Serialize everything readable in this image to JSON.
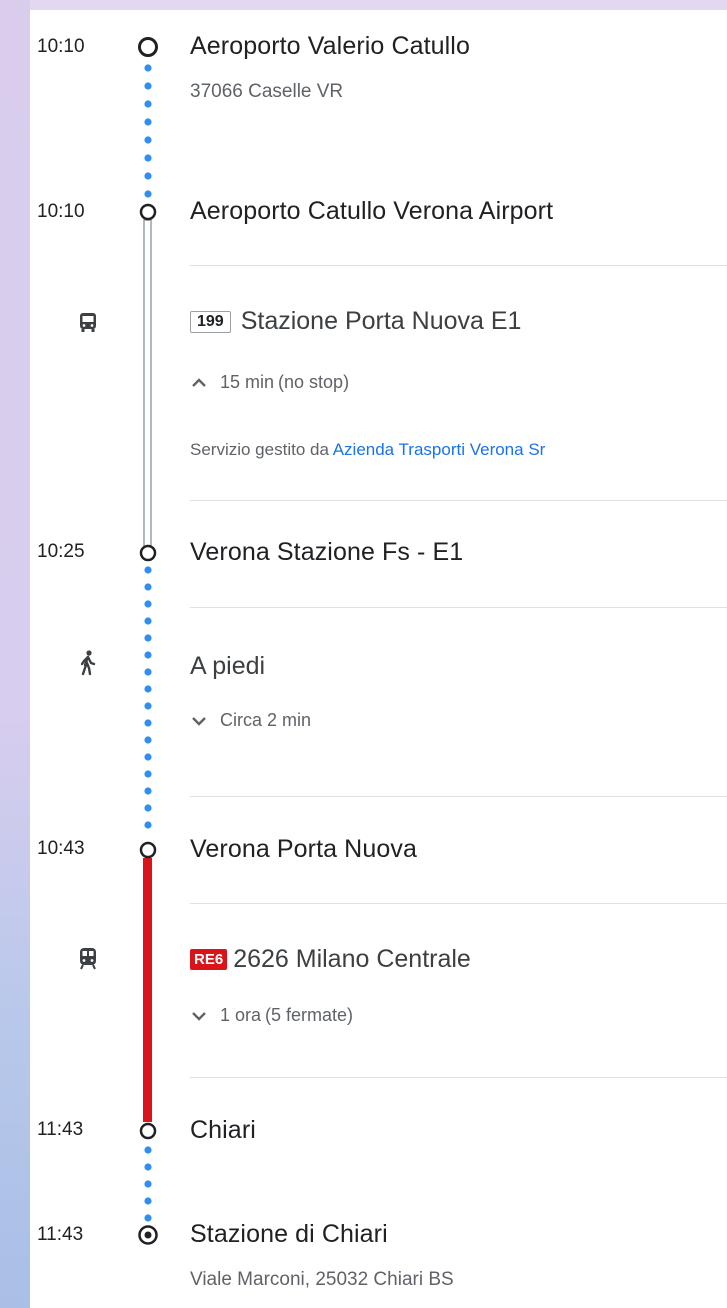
{
  "colors": {
    "walk_dot": "#2f8ff0",
    "bus_line": "#9aa0a6",
    "train_line": "#d9141b",
    "link": "#1a73e8",
    "badge_red": "#d9141b"
  },
  "itinerary": {
    "origin": {
      "time": "10:10",
      "name": "Aeroporto Valerio Catullo",
      "address": "37066 Caselle VR",
      "icon": "origin-circle-icon"
    },
    "bus_stop": {
      "time": "10:10",
      "name": "Aeroporto Catullo Verona Airport"
    },
    "bus_leg": {
      "icon": "bus-icon",
      "route": "199",
      "headsign": "Stazione Porta Nuova E1",
      "duration": "15 min",
      "stops_note": "(no stop)",
      "expand_icon": "chevron-up-icon",
      "operator_prefix": "Servizio gestito da",
      "operator_name": "Azienda Trasporti Verona Sr"
    },
    "bus_arrival": {
      "time": "10:25",
      "name": "Verona Stazione Fs - E1"
    },
    "walk_leg": {
      "icon": "walking-icon",
      "label": "A piedi",
      "duration": "Circa 2 min",
      "expand_icon": "chevron-down-icon"
    },
    "train_stop": {
      "time": "10:43",
      "name": "Verona Porta Nuova"
    },
    "train_leg": {
      "icon": "train-icon",
      "badge": "RE6",
      "number_headsign": "2626 Milano Centrale",
      "duration": "1 ora",
      "stops_note": "(5 fermate)",
      "expand_icon": "chevron-down-icon"
    },
    "train_arrival": {
      "time": "11:43",
      "name": "Chiari"
    },
    "destination": {
      "time": "11:43",
      "name": "Stazione di Chiari",
      "address": "Viale Marconi, 25032 Chiari BS",
      "icon": "destination-target-icon"
    }
  }
}
